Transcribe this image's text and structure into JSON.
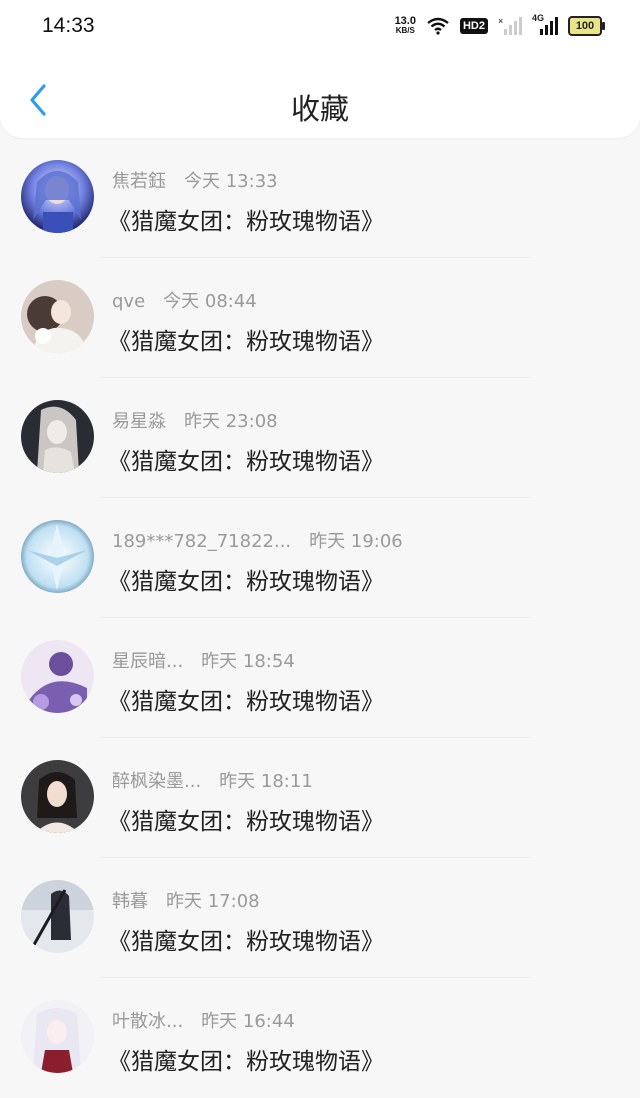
{
  "status": {
    "time": "14:33",
    "net_speed": "13.0",
    "net_unit": "KB/S",
    "hd": "HD2",
    "network_type": "4G",
    "battery": "100"
  },
  "header": {
    "title": "收藏",
    "back_icon": "chevron-left-icon"
  },
  "items": [
    {
      "name": "焦若鈺",
      "time": "今天 13:33",
      "title": "《猎魔女团：粉玫瑰物语》"
    },
    {
      "name": "qve",
      "time": "今天 08:44",
      "title": "《猎魔女团：粉玫瑰物语》"
    },
    {
      "name": "易星淼",
      "time": "昨天 23:08",
      "title": "《猎魔女团：粉玫瑰物语》"
    },
    {
      "name": "189***782_71822...",
      "time": "昨天 19:06",
      "title": "《猎魔女团：粉玫瑰物语》"
    },
    {
      "name": "星辰暗...",
      "time": "昨天 18:54",
      "title": "《猎魔女团：粉玫瑰物语》"
    },
    {
      "name": "醉枫染墨...",
      "time": "昨天 18:11",
      "title": "《猎魔女团：粉玫瑰物语》"
    },
    {
      "name": "韩暮",
      "time": "昨天 17:08",
      "title": "《猎魔女团：粉玫瑰物语》"
    },
    {
      "name": "叶散冰...",
      "time": "昨天 16:44",
      "title": "《猎魔女团：粉玫瑰物语》"
    }
  ],
  "colors": {
    "accent": "#2d9cf0",
    "meta_text": "#9a9a9a",
    "title_text": "#222222"
  }
}
